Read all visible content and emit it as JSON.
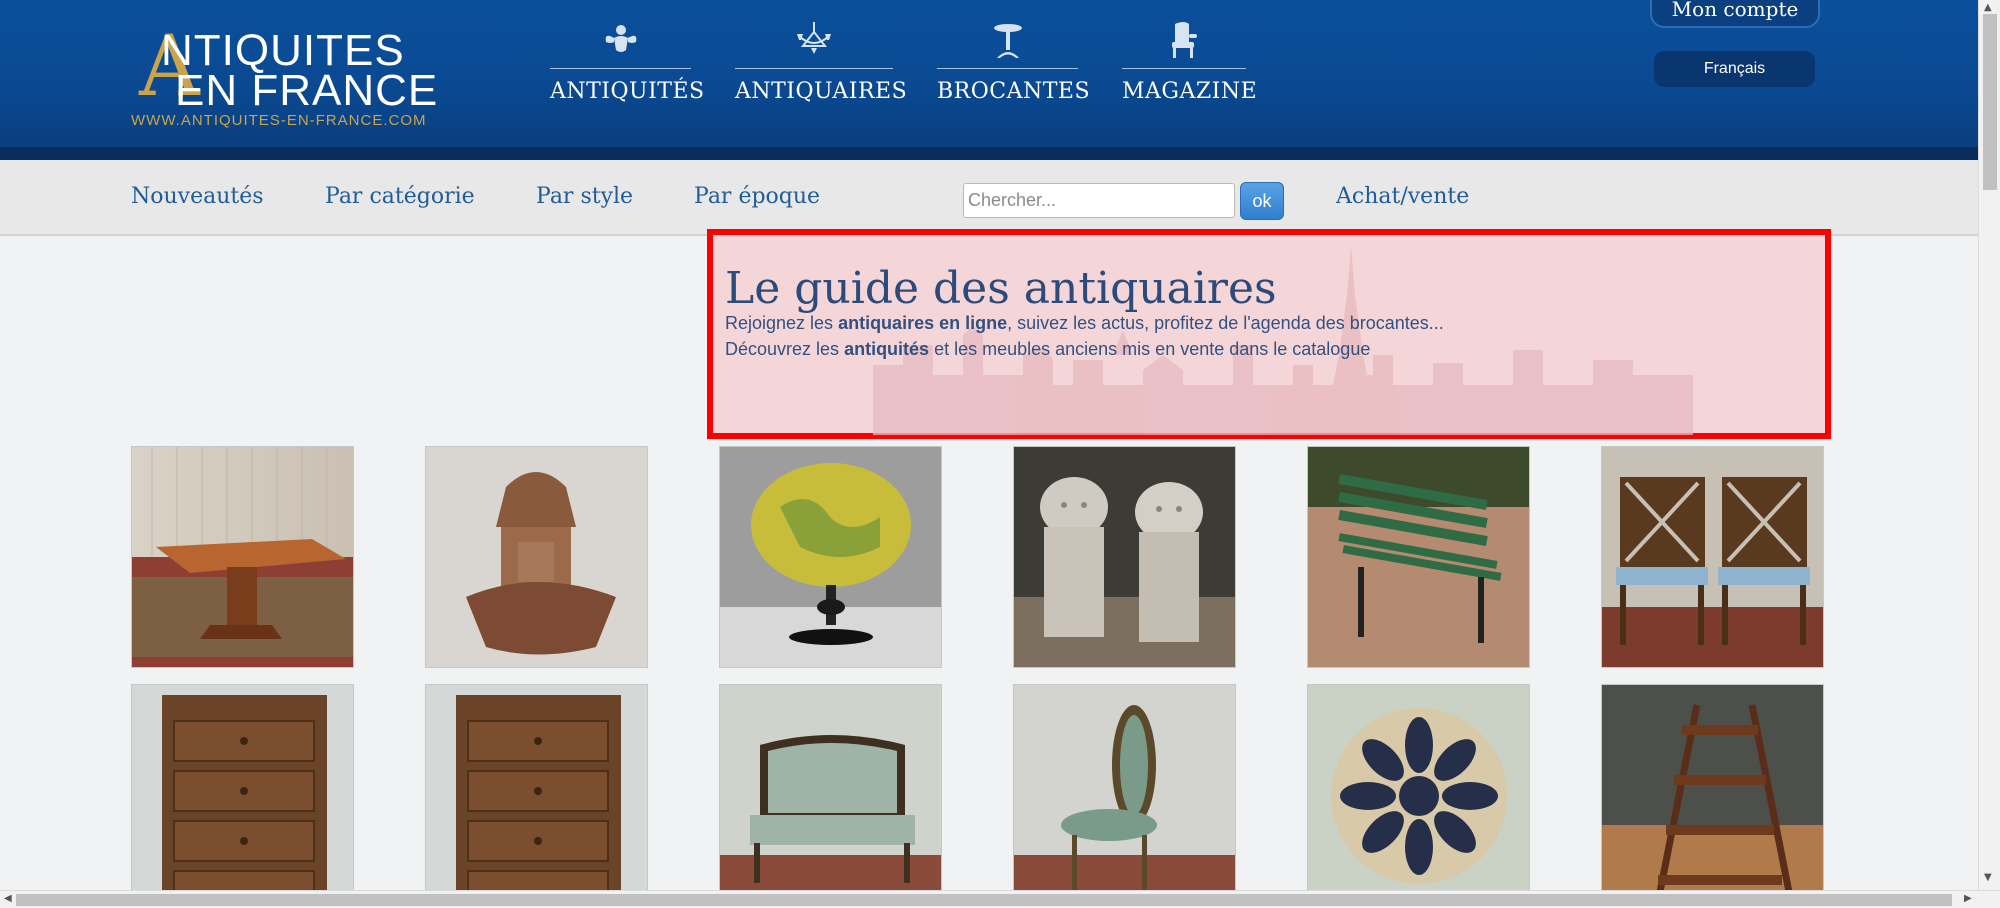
{
  "header": {
    "logo": {
      "letter": "A",
      "line1": "NTIQUITES",
      "line2": "EN FRANCE",
      "url": "WWW.ANTIQUITES-EN-FRANCE.COM"
    },
    "nav": [
      {
        "label": "ANTIQUITÉS",
        "icon": "cherub-icon"
      },
      {
        "label": "ANTIQUAIRES",
        "icon": "chandelier-icon"
      },
      {
        "label": "BROCANTES",
        "icon": "pedestal-table-icon"
      },
      {
        "label": "MAGAZINE",
        "icon": "armchair-icon"
      }
    ],
    "account": "Mon compte",
    "language": "Français"
  },
  "subnav": {
    "links": [
      "Nouveautés",
      "Par catégorie",
      "Par style",
      "Par époque"
    ],
    "search_placeholder": "Chercher...",
    "search_button": "ok",
    "buy_sell": "Achat/vente"
  },
  "hero": {
    "title": "Le guide des antiquaires",
    "line1_pre": "Rejoignez les ",
    "line1_bold": "antiquaires en ligne",
    "line1_post": ", suivez les actus, profitez de l'agenda des brocantes...",
    "line2_pre": "Découvrez les ",
    "line2_bold": "antiquités",
    "line2_post": " et les meubles anciens mis en vente dans le catalogue"
  },
  "products": [
    {
      "name": "octagonal-table"
    },
    {
      "name": "wall-fountain"
    },
    {
      "name": "globe"
    },
    {
      "name": "stone-lions"
    },
    {
      "name": "garden-bench"
    },
    {
      "name": "pair-of-chairs"
    },
    {
      "name": "chest-of-drawers"
    },
    {
      "name": "chest-of-drawers"
    },
    {
      "name": "settee"
    },
    {
      "name": "side-chair"
    },
    {
      "name": "round-rug"
    },
    {
      "name": "library-steps"
    }
  ],
  "colors": {
    "header_blue": "#0b4f9a",
    "gold": "#c9a44a",
    "link_blue": "#1f5c9a",
    "highlight_red": "#ff0000"
  }
}
